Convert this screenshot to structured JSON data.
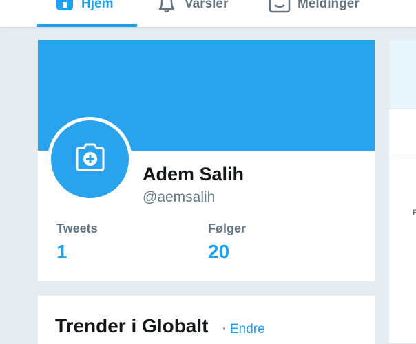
{
  "nav": {
    "home_label": "Hjem",
    "notifications_label": "Varsler",
    "messages_label": "Meldinger",
    "icons": [
      "home-icon",
      "bell-icon",
      "envelope-icon"
    ],
    "active_color": "#1da1f2"
  },
  "profile": {
    "name": "Adem Salih",
    "handle": "@aemsalih",
    "banner_color": "#2aa3ef",
    "avatar_icon": "camera-add-icon",
    "stats": {
      "tweets_label": "Tweets",
      "tweets_value": "1",
      "following_label": "Følger",
      "following_value": "20"
    }
  },
  "trends": {
    "title": "Trender i Globalt",
    "separator": "·",
    "change_link": "Endre"
  },
  "right_column": {
    "partial_text": "F"
  }
}
